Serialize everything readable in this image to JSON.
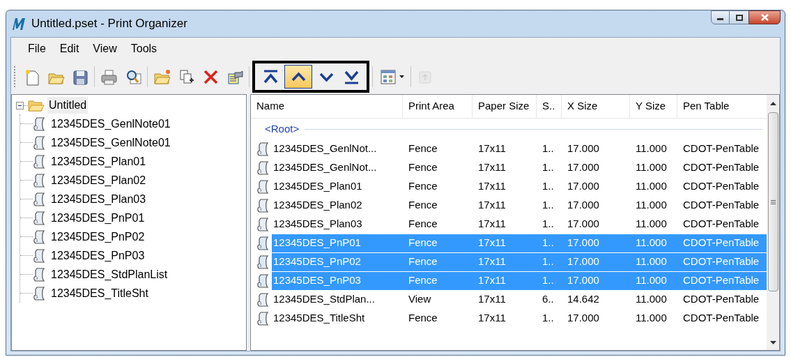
{
  "window": {
    "title": "Untitled.pset - Print Organizer"
  },
  "menu": [
    "File",
    "Edit",
    "View",
    "Tools"
  ],
  "toolbar": {
    "groups": [
      {
        "outlined": false,
        "buttons": [
          {
            "kind": "new",
            "hot": false,
            "disabled": false
          },
          {
            "kind": "open",
            "hot": false,
            "disabled": false
          },
          {
            "kind": "save",
            "hot": false,
            "disabled": false
          }
        ]
      },
      {
        "outlined": false,
        "buttons": [
          {
            "kind": "print",
            "hot": false,
            "disabled": false
          },
          {
            "kind": "preview",
            "hot": false,
            "disabled": false
          }
        ]
      },
      {
        "outlined": false,
        "buttons": [
          {
            "kind": "newfolder",
            "hot": false,
            "disabled": false
          },
          {
            "kind": "add",
            "hot": false,
            "disabled": false
          },
          {
            "kind": "delete",
            "hot": false,
            "disabled": false
          },
          {
            "kind": "properties",
            "hot": false,
            "disabled": false
          }
        ]
      },
      {
        "outlined": true,
        "buttons": [
          {
            "kind": "top",
            "hot": false,
            "disabled": false
          },
          {
            "kind": "up",
            "hot": true,
            "disabled": false
          },
          {
            "kind": "down",
            "hot": false,
            "disabled": false
          },
          {
            "kind": "bottom",
            "hot": false,
            "disabled": false
          }
        ]
      },
      {
        "outlined": false,
        "buttons": [
          {
            "kind": "viewmenu",
            "hot": false,
            "disabled": false
          }
        ]
      },
      {
        "outlined": false,
        "buttons": [
          {
            "kind": "uplevel",
            "hot": false,
            "disabled": true
          }
        ]
      }
    ]
  },
  "tree": {
    "label": "Untitled",
    "expanded": true,
    "children": [
      {
        "label": "12345DES_GenlNote01"
      },
      {
        "label": "12345DES_GenlNote01"
      },
      {
        "label": "12345DES_Plan01"
      },
      {
        "label": "12345DES_Plan02"
      },
      {
        "label": "12345DES_Plan03"
      },
      {
        "label": "12345DES_PnP01"
      },
      {
        "label": "12345DES_PnP02"
      },
      {
        "label": "12345DES_PnP03"
      },
      {
        "label": "12345DES_StdPlanList"
      },
      {
        "label": "12345DES_TitleSht"
      }
    ]
  },
  "table": {
    "columns": [
      "Name",
      "Print Area",
      "Paper Size",
      "S..",
      "X Size",
      "Y Size",
      "Pen Table"
    ],
    "group": "<Root>",
    "rows": [
      {
        "cells": [
          "12345DES_GenlNot...",
          "Fence",
          "17x11",
          "1..",
          "17.000",
          "11.000",
          "CDOT-PenTable"
        ],
        "selected": false
      },
      {
        "cells": [
          "12345DES_GenlNot...",
          "Fence",
          "17x11",
          "1..",
          "17.000",
          "11.000",
          "CDOT-PenTable"
        ],
        "selected": false
      },
      {
        "cells": [
          "12345DES_Plan01",
          "Fence",
          "17x11",
          "1..",
          "17.000",
          "11.000",
          "CDOT-PenTable"
        ],
        "selected": false
      },
      {
        "cells": [
          "12345DES_Plan02",
          "Fence",
          "17x11",
          "1..",
          "17.000",
          "11.000",
          "CDOT-PenTable"
        ],
        "selected": false
      },
      {
        "cells": [
          "12345DES_Plan03",
          "Fence",
          "17x11",
          "1..",
          "17.000",
          "11.000",
          "CDOT-PenTable"
        ],
        "selected": false
      },
      {
        "cells": [
          "12345DES_PnP01",
          "Fence",
          "17x11",
          "1..",
          "17.000",
          "11.000",
          "CDOT-PenTable"
        ],
        "selected": true
      },
      {
        "cells": [
          "12345DES_PnP02",
          "Fence",
          "17x11",
          "1..",
          "17.000",
          "11.000",
          "CDOT-PenTable"
        ],
        "selected": true
      },
      {
        "cells": [
          "12345DES_PnP03",
          "Fence",
          "17x11",
          "1..",
          "17.000",
          "11.000",
          "CDOT-PenTable"
        ],
        "selected": true
      },
      {
        "cells": [
          "12345DES_StdPlan...",
          "View",
          "17x11",
          "6..",
          "14.642",
          "11.000",
          "CDOT-PenTable"
        ],
        "selected": false
      },
      {
        "cells": [
          "12345DES_TitleSht",
          "Fence",
          "17x11",
          "1..",
          "17.000",
          "11.000",
          "CDOT-PenTable"
        ],
        "selected": false
      }
    ]
  }
}
